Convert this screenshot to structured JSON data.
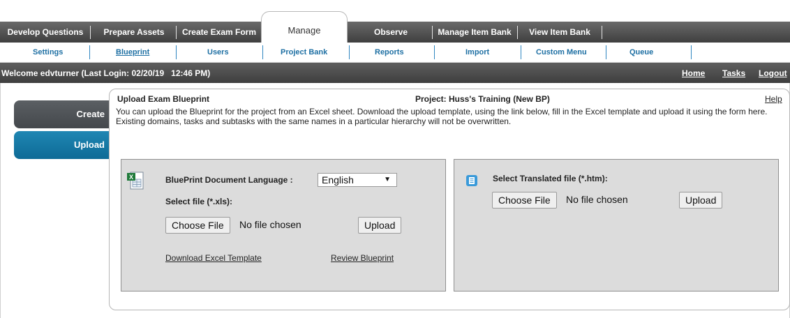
{
  "tabs": {
    "develop_questions": "Develop Questions",
    "prepare_assets": "Prepare Assets",
    "create_exam_form": "Create Exam Form",
    "manage": "Manage",
    "observe": "Observe",
    "manage_item_bank": "Manage Item Bank",
    "view_item_bank": "View Item Bank"
  },
  "subnav": {
    "settings": "Settings",
    "blueprint": "Blueprint",
    "users": "Users",
    "project_bank": "Project Bank",
    "reports": "Reports",
    "import": "Import",
    "custom_menu": "Custom Menu",
    "queue": "Queue"
  },
  "welcome": {
    "text": "Welcome edvturner (Last Login: 02/20/19   12:46 PM)",
    "home": "Home",
    "tasks": "Tasks",
    "logout": "Logout"
  },
  "side": {
    "create": "Create",
    "upload": "Upload"
  },
  "panel": {
    "title": "Upload Exam Blueprint",
    "project": "Project: Huss's Training (New BP)",
    "help": "Help",
    "description": "You can upload the Blueprint for the project from an Excel sheet. Download the upload template, using the link below, fill in the Excel template and upload it using the form here. Existing domains, tasks and subtasks with the same names in a particular hierarchy will not be overwritten."
  },
  "left_box": {
    "language_label": "BluePrint Document Language :",
    "language_value": "English",
    "select_file_label": "Select file (*.xls):",
    "choose_file": "Choose File",
    "no_file": "No file chosen",
    "upload": "Upload",
    "download_template": "Download Excel Template",
    "review_blueprint": "Review Blueprint"
  },
  "right_box": {
    "select_label": "Select Translated file (*.htm):",
    "choose_file": "Choose File",
    "no_file": "No file chosen",
    "upload": "Upload"
  },
  "icons": {
    "excel": "excel-file-icon",
    "htm": "document-icon"
  },
  "colors": {
    "tab_bar": "#4f4f4f",
    "link_blue": "#1d6fa3",
    "upload_blue": "#0e6b96",
    "box_gray": "#dcdcdc"
  }
}
